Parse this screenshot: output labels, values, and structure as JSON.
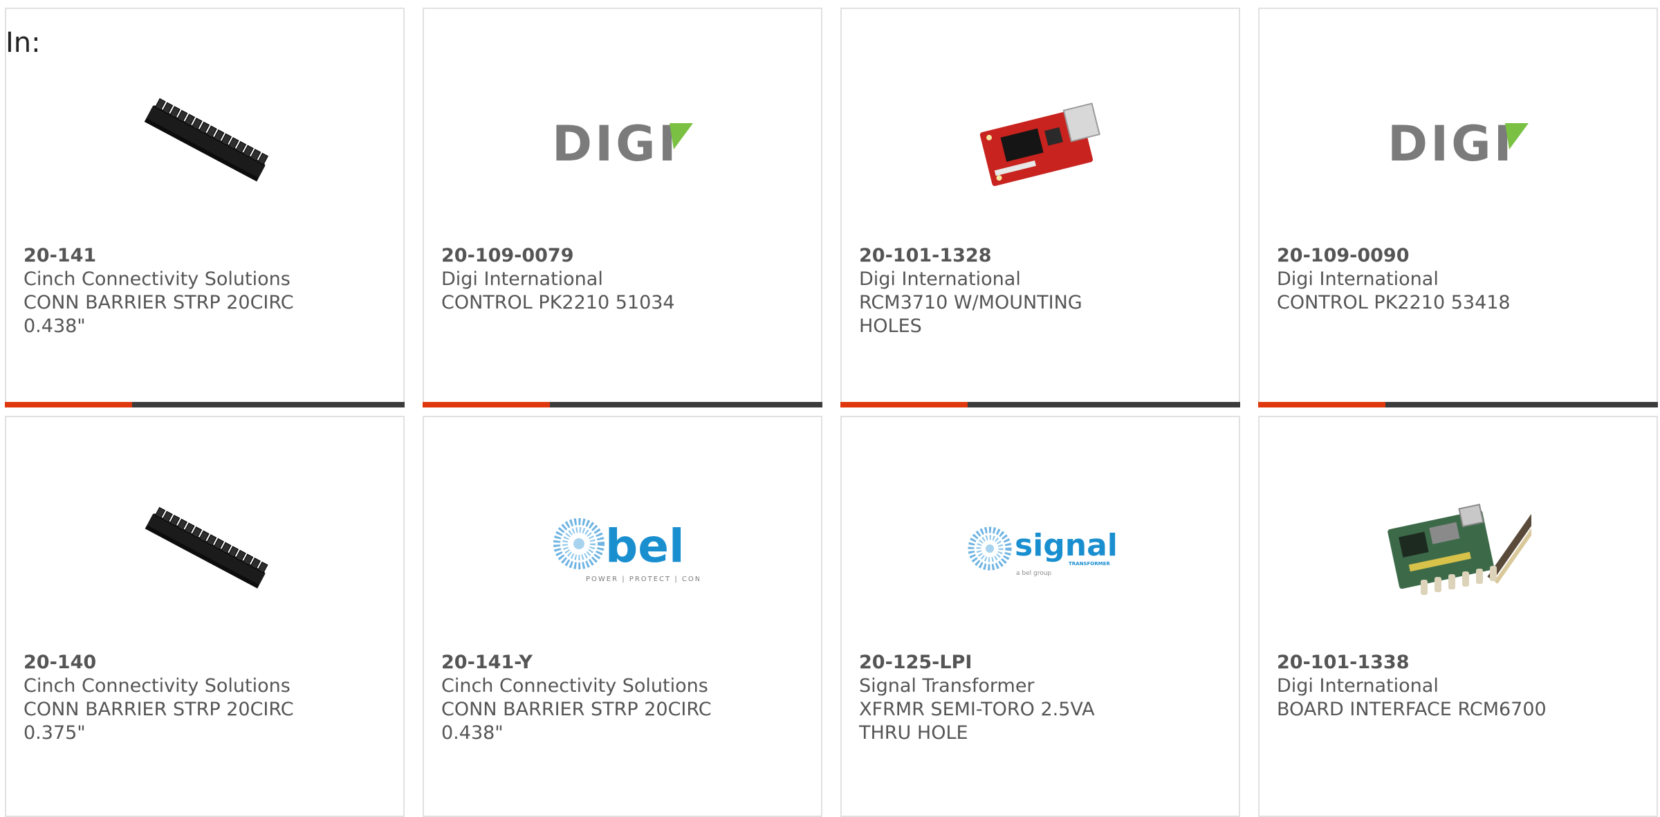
{
  "filter_label": "In:",
  "colors": {
    "accent": "#e0380e",
    "bar_dark": "#3c3c3c",
    "text": "#555555",
    "card_border": "#e1e1e1",
    "digi_green": "#7ac143",
    "bel_blue": "#1a8fd0"
  },
  "products": [
    {
      "part_number": "20-141",
      "manufacturer": "Cinch Connectivity Solutions",
      "description": "CONN BARRIER STRP 20CIRC 0.438\"",
      "image": "barrier-strip-image"
    },
    {
      "part_number": "20-109-0079",
      "manufacturer": "Digi International",
      "description": "CONTROL PK2210 51034",
      "image": "digi-logo",
      "logo_text": "DIGI"
    },
    {
      "part_number": "20-101-1328",
      "manufacturer": "Digi International",
      "description": "RCM3710 W/MOUNTING HOLES",
      "image": "red-module-image"
    },
    {
      "part_number": "20-109-0090",
      "manufacturer": "Digi International",
      "description": "CONTROL PK2210 53418",
      "image": "digi-logo",
      "logo_text": "DIGI"
    },
    {
      "part_number": "20-140",
      "manufacturer": "Cinch Connectivity Solutions",
      "description": "CONN BARRIER STRP 20CIRC 0.375\"",
      "image": "barrier-strip-image"
    },
    {
      "part_number": "20-141-Y",
      "manufacturer": "Cinch Connectivity Solutions",
      "description": "CONN BARRIER STRP 20CIRC 0.438\"",
      "image": "bel-logo",
      "logo_text": "bel",
      "logo_tagline": "POWER | PROTECT | CONNECT"
    },
    {
      "part_number": "20-125-LPI",
      "manufacturer": "Signal Transformer",
      "description": "XFRMR SEMI-TORO 2.5VA THRU HOLE",
      "image": "signal-logo",
      "logo_text": "signal",
      "logo_sub": "TRANSFORMER",
      "logo_tagline": "a bel group"
    },
    {
      "part_number": "20-101-1338",
      "manufacturer": "Digi International",
      "description": "BOARD INTERFACE RCM6700",
      "image": "green-board-image"
    }
  ]
}
